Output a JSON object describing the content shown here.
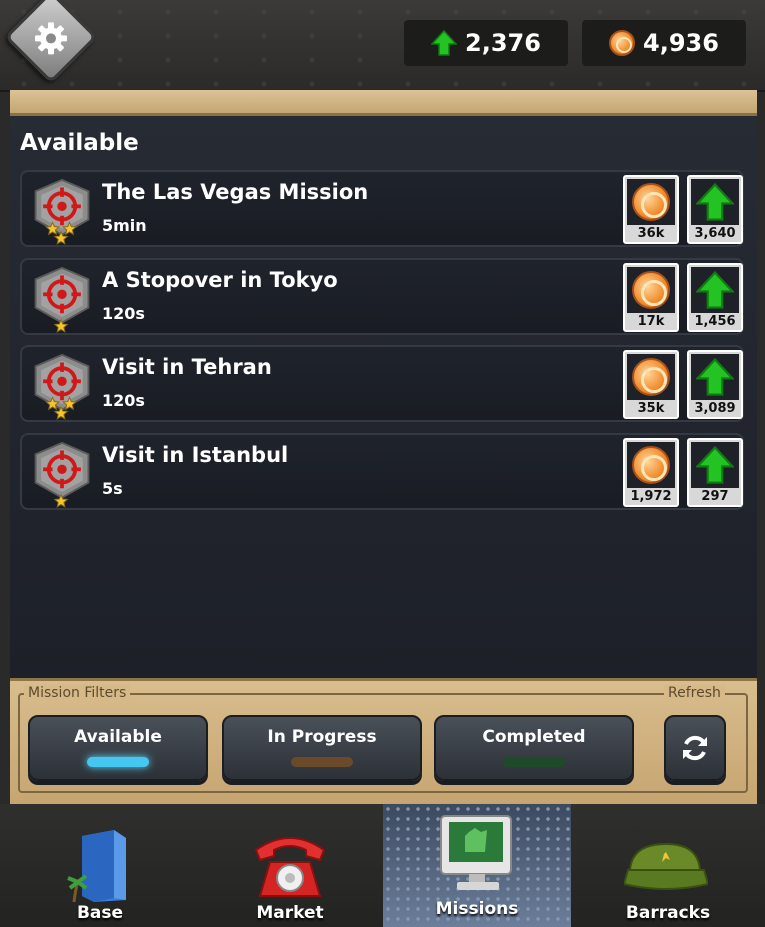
{
  "header": {
    "settings_icon": "gear-icon",
    "xp": "2,376",
    "coins": "4,936"
  },
  "section_title": "Available",
  "missions": [
    {
      "title": "The Las Vegas Mission",
      "duration": "5min",
      "stars": 3,
      "coin_reward": "36k",
      "xp_reward": "3,640"
    },
    {
      "title": "A Stopover in Tokyo",
      "duration": "120s",
      "stars": 1,
      "coin_reward": "17k",
      "xp_reward": "1,456"
    },
    {
      "title": "Visit in Tehran",
      "duration": "120s",
      "stars": 3,
      "coin_reward": "35k",
      "xp_reward": "3,089"
    },
    {
      "title": "Visit in Istanbul",
      "duration": "5s",
      "stars": 1,
      "coin_reward": "1,972",
      "xp_reward": "297"
    }
  ],
  "filters": {
    "title": "Mission Filters",
    "refresh_label": "Refresh",
    "available": "Available",
    "in_progress": "In Progress",
    "completed": "Completed",
    "active": "available",
    "colors": {
      "available": "#44c8f2",
      "in_progress": "#6b4a2a",
      "completed": "#1f4a2a"
    }
  },
  "nav": {
    "base": "Base",
    "market": "Market",
    "missions": "Missions",
    "barracks": "Barracks",
    "active": "missions"
  },
  "colors": {
    "xp_arrow": "#22c322",
    "target_red": "#d01818",
    "star": "#f5c430"
  }
}
